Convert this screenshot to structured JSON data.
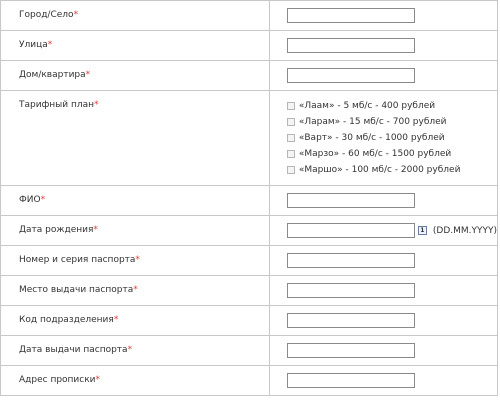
{
  "form": {
    "required_mark": "*",
    "rows": [
      {
        "label": "Город/Село",
        "value": ""
      },
      {
        "label": "Улица",
        "value": ""
      },
      {
        "label": "Дом/квартира",
        "value": ""
      },
      {
        "label": "Тарифный план"
      },
      {
        "label": "ФИО",
        "value": ""
      },
      {
        "label": "Дата рождения",
        "value": "",
        "hint": "(DD.MM.YYYY)"
      },
      {
        "label": "Номер и серия паспорта",
        "value": ""
      },
      {
        "label": "Место выдачи паспорта",
        "value": ""
      },
      {
        "label": "Код подразделения",
        "value": ""
      },
      {
        "label": "Дата выдачи паспорта",
        "value": ""
      },
      {
        "label": "Адрес прописки",
        "value": ""
      }
    ],
    "plans": [
      {
        "label": "«Лаам» - 5 мб/с - 400 рублей",
        "checked": false
      },
      {
        "label": "«Ларам» - 15 мб/с - 700 рублей",
        "checked": false
      },
      {
        "label": "«Варт» - 30 мб/с - 1000 рублей",
        "checked": false
      },
      {
        "label": "«Марзо» - 60 мб/с - 1500 рублей",
        "checked": false
      },
      {
        "label": "«Маршо» - 100 мб/с - 2000 рублей",
        "checked": false
      }
    ],
    "calendar_icon_text": "1"
  }
}
